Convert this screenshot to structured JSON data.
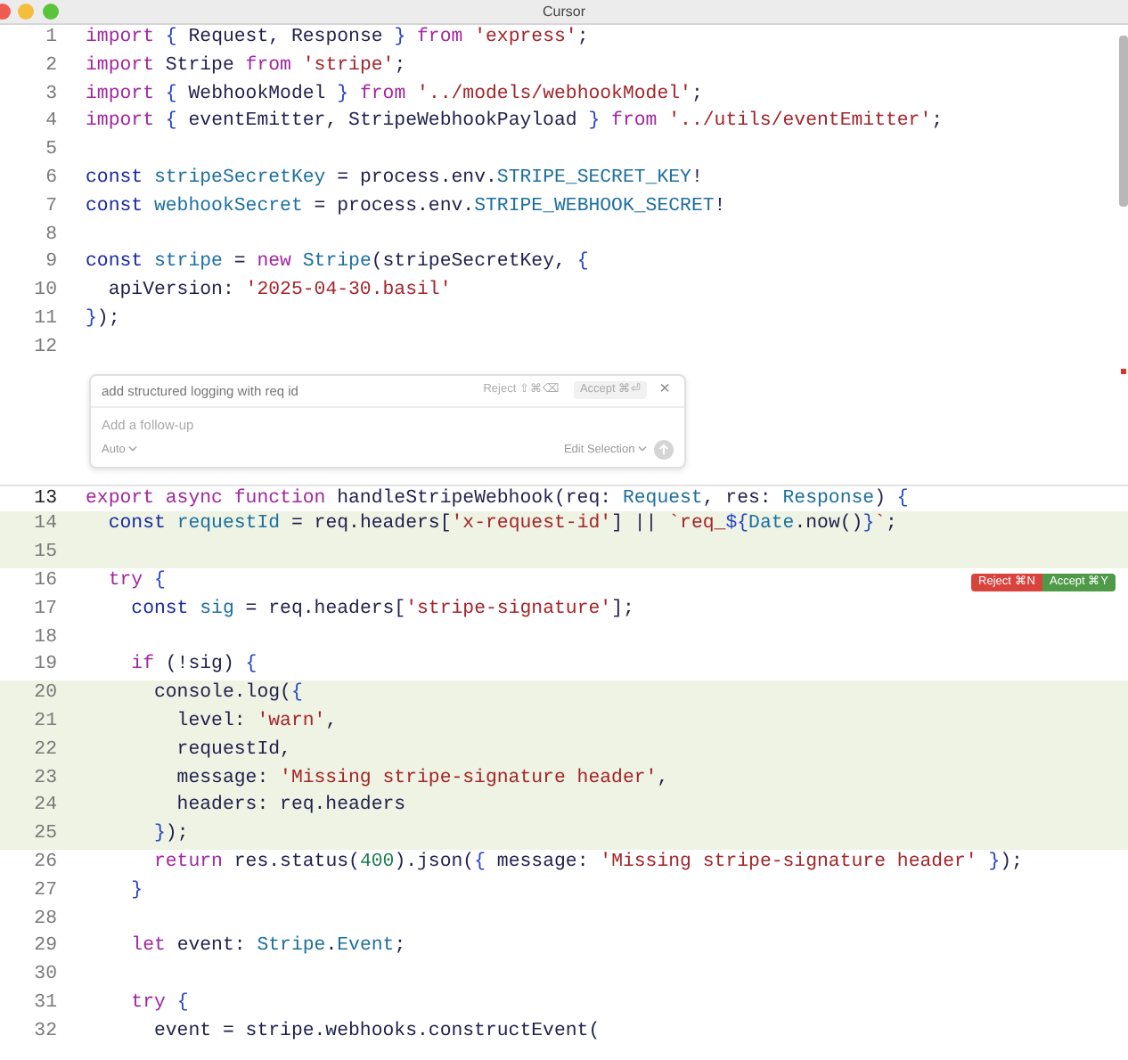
{
  "window": {
    "title": "Cursor"
  },
  "editor": {
    "lines_before": [
      {
        "number": "1",
        "added": false,
        "current": false,
        "tokens": [
          {
            "kind": "k",
            "text": "import "
          },
          {
            "kind": "b",
            "text": "{"
          },
          {
            "kind": "p",
            "text": " Request, Response "
          },
          {
            "kind": "b",
            "text": "} "
          },
          {
            "kind": "k",
            "text": "from "
          },
          {
            "kind": "s",
            "text": "'express'"
          },
          {
            "kind": "p",
            "text": ";"
          }
        ]
      },
      {
        "number": "2",
        "added": false,
        "current": false,
        "tokens": [
          {
            "kind": "k",
            "text": "import"
          },
          {
            "kind": "p",
            "text": " Stripe "
          },
          {
            "kind": "k",
            "text": "from "
          },
          {
            "kind": "s",
            "text": "'stripe'"
          },
          {
            "kind": "p",
            "text": ";"
          }
        ]
      },
      {
        "number": "3",
        "added": false,
        "current": false,
        "tokens": [
          {
            "kind": "k",
            "text": "import "
          },
          {
            "kind": "b",
            "text": "{"
          },
          {
            "kind": "p",
            "text": " WebhookModel "
          },
          {
            "kind": "b",
            "text": "} "
          },
          {
            "kind": "k",
            "text": "from "
          },
          {
            "kind": "s",
            "text": "'../models/webhookModel'"
          },
          {
            "kind": "p",
            "text": ";"
          }
        ]
      },
      {
        "number": "4",
        "added": false,
        "current": false,
        "tokens": [
          {
            "kind": "k",
            "text": "import "
          },
          {
            "kind": "b",
            "text": "{"
          },
          {
            "kind": "p",
            "text": " eventEmitter, StripeWebhookPayload "
          },
          {
            "kind": "b",
            "text": "} "
          },
          {
            "kind": "k",
            "text": "from "
          },
          {
            "kind": "s",
            "text": "'../utils/eventEmitter'"
          },
          {
            "kind": "p",
            "text": ";"
          }
        ]
      },
      {
        "number": "5",
        "added": false,
        "current": false
      },
      {
        "number": "6",
        "added": false,
        "current": false,
        "tokens": [
          {
            "kind": "d",
            "text": "const "
          },
          {
            "kind": "v",
            "text": "stripeSecretKey"
          },
          {
            "kind": "p",
            "text": " = process.env."
          },
          {
            "kind": "v",
            "text": "STRIPE_SECRET_KEY"
          },
          {
            "kind": "p",
            "text": "!"
          }
        ]
      },
      {
        "number": "7",
        "added": false,
        "current": false,
        "tokens": [
          {
            "kind": "d",
            "text": "const "
          },
          {
            "kind": "v",
            "text": "webhookSecret"
          },
          {
            "kind": "p",
            "text": " = process.env."
          },
          {
            "kind": "v",
            "text": "STRIPE_WEBHOOK_SECRET"
          },
          {
            "kind": "p",
            "text": "!"
          }
        ]
      },
      {
        "number": "8",
        "added": false,
        "current": false
      },
      {
        "number": "9",
        "added": false,
        "current": false,
        "tokens": [
          {
            "kind": "d",
            "text": "const "
          },
          {
            "kind": "v",
            "text": "stripe"
          },
          {
            "kind": "p",
            "text": " = "
          },
          {
            "kind": "k",
            "text": "new "
          },
          {
            "kind": "v",
            "text": "Stripe"
          },
          {
            "kind": "p",
            "text": "(stripeSecretKey, "
          },
          {
            "kind": "b",
            "text": "{"
          }
        ]
      },
      {
        "number": "10",
        "added": false,
        "current": false,
        "tokens": [
          {
            "kind": "p",
            "text": "  apiVersion: "
          },
          {
            "kind": "s",
            "text": "'2025-04-30.basil'"
          }
        ]
      },
      {
        "number": "11",
        "added": false,
        "current": false,
        "tokens": [
          {
            "kind": "b",
            "text": "}"
          },
          {
            "kind": "p",
            "text": ");"
          }
        ]
      },
      {
        "number": "12",
        "added": false,
        "current": false
      }
    ],
    "inline_prompt": {
      "prompt": "add structured logging with req id",
      "reject": "Reject ⇧⌘⌫",
      "accept": "Accept ⌘⏎",
      "close": "×",
      "placeholder": "Add a follow-up",
      "model": "Auto",
      "mode": "Edit Selection"
    },
    "lines_after": [
      {
        "number": "13",
        "added": false,
        "current": true,
        "tokens": [
          {
            "kind": "k",
            "text": "export async function"
          },
          {
            "kind": "p",
            "text": " handleStripeWebhook(req: "
          },
          {
            "kind": "v",
            "text": "Request"
          },
          {
            "kind": "p",
            "text": ", res: "
          },
          {
            "kind": "v",
            "text": "Response"
          },
          {
            "kind": "p",
            "text": ") "
          },
          {
            "kind": "b",
            "text": "{"
          }
        ]
      },
      {
        "number": "14",
        "added": true,
        "current": false,
        "tokens": [
          {
            "kind": "d",
            "text": "  const "
          },
          {
            "kind": "v",
            "text": "requestId"
          },
          {
            "kind": "p",
            "text": " = req.headers["
          },
          {
            "kind": "s",
            "text": "'x-request-id'"
          },
          {
            "kind": "p",
            "text": "] || "
          },
          {
            "kind": "s",
            "text": "`req_"
          },
          {
            "kind": "b",
            "text": "${"
          },
          {
            "kind": "v",
            "text": "Date"
          },
          {
            "kind": "p",
            "text": ".now()"
          },
          {
            "kind": "b",
            "text": "}"
          },
          {
            "kind": "s",
            "text": "`"
          },
          {
            "kind": "p",
            "text": ";"
          }
        ]
      },
      {
        "number": "15",
        "added": true,
        "current": false
      },
      {
        "number": "16",
        "added": false,
        "current": false,
        "tokens": [
          {
            "kind": "k",
            "text": "  try "
          },
          {
            "kind": "b",
            "text": "{"
          }
        ],
        "actions": [
          {
            "kind": "reject",
            "label": "Reject ⌘N"
          },
          {
            "kind": "accept",
            "label": "Accept ⌘Y"
          }
        ]
      },
      {
        "number": "17",
        "added": false,
        "current": false,
        "tokens": [
          {
            "kind": "d",
            "text": "    const "
          },
          {
            "kind": "v",
            "text": "sig"
          },
          {
            "kind": "p",
            "text": " = req.headers["
          },
          {
            "kind": "s",
            "text": "'stripe-signature'"
          },
          {
            "kind": "p",
            "text": "];"
          }
        ]
      },
      {
        "number": "18",
        "added": false,
        "current": false
      },
      {
        "number": "19",
        "added": false,
        "current": false,
        "tokens": [
          {
            "kind": "k",
            "text": "    if"
          },
          {
            "kind": "p",
            "text": " (!sig) "
          },
          {
            "kind": "b",
            "text": "{"
          }
        ]
      },
      {
        "number": "20",
        "added": true,
        "current": false,
        "tokens": [
          {
            "kind": "p",
            "text": "      console.log("
          },
          {
            "kind": "b",
            "text": "{"
          }
        ]
      },
      {
        "number": "21",
        "added": true,
        "current": false,
        "tokens": [
          {
            "kind": "p",
            "text": "        level: "
          },
          {
            "kind": "s",
            "text": "'warn'"
          },
          {
            "kind": "p",
            "text": ","
          }
        ]
      },
      {
        "number": "22",
        "added": true,
        "current": false,
        "tokens": [
          {
            "kind": "p",
            "text": "        requestId,"
          }
        ]
      },
      {
        "number": "23",
        "added": true,
        "current": false,
        "tokens": [
          {
            "kind": "p",
            "text": "        message: "
          },
          {
            "kind": "s",
            "text": "'Missing stripe-signature header'"
          },
          {
            "kind": "p",
            "text": ","
          }
        ]
      },
      {
        "number": "24",
        "added": true,
        "current": false,
        "tokens": [
          {
            "kind": "p",
            "text": "        headers: req.headers"
          }
        ]
      },
      {
        "number": "25",
        "added": true,
        "current": false,
        "tokens": [
          {
            "kind": "b",
            "text": "      }"
          },
          {
            "kind": "p",
            "text": ");"
          }
        ]
      },
      {
        "number": "26",
        "added": false,
        "current": false,
        "tokens": [
          {
            "kind": "k",
            "text": "      return"
          },
          {
            "kind": "p",
            "text": " res.status("
          },
          {
            "kind": "n",
            "text": "400"
          },
          {
            "kind": "p",
            "text": ").json("
          },
          {
            "kind": "b",
            "text": "{"
          },
          {
            "kind": "p",
            "text": " message: "
          },
          {
            "kind": "s",
            "text": "'Missing stripe-signature header'"
          },
          {
            "kind": "b",
            "text": " }"
          },
          {
            "kind": "p",
            "text": ");"
          }
        ]
      },
      {
        "number": "27",
        "added": false,
        "current": false,
        "tokens": [
          {
            "kind": "b",
            "text": "    }"
          }
        ]
      },
      {
        "number": "28",
        "added": false,
        "current": false
      },
      {
        "number": "29",
        "added": false,
        "current": false,
        "tokens": [
          {
            "kind": "k",
            "text": "    let"
          },
          {
            "kind": "p",
            "text": " event: "
          },
          {
            "kind": "v",
            "text": "Stripe"
          },
          {
            "kind": "p",
            "text": "."
          },
          {
            "kind": "v",
            "text": "Event"
          },
          {
            "kind": "p",
            "text": ";"
          }
        ]
      },
      {
        "number": "30",
        "added": false,
        "current": false
      },
      {
        "number": "31",
        "added": false,
        "current": false,
        "tokens": [
          {
            "kind": "k",
            "text": "    try "
          },
          {
            "kind": "b",
            "text": "{"
          }
        ]
      },
      {
        "number": "32",
        "added": false,
        "current": false,
        "tokens": [
          {
            "kind": "p",
            "text": "      event = stripe.webhooks.constructEvent("
          }
        ]
      }
    ]
  }
}
